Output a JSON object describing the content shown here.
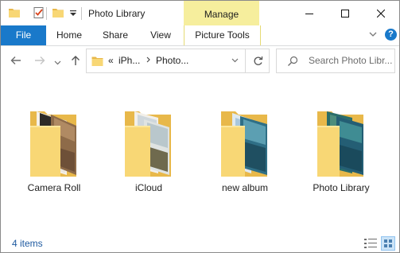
{
  "titlebar": {
    "title": "Photo Library",
    "contextual_tab": "Manage",
    "controls": {
      "minimize": "minimize",
      "maximize": "maximize",
      "close": "close"
    }
  },
  "ribbon": {
    "tabs": [
      {
        "label": "File"
      },
      {
        "label": "Home"
      },
      {
        "label": "Share"
      },
      {
        "label": "View"
      },
      {
        "label": "Picture Tools"
      }
    ],
    "help": "?"
  },
  "address": {
    "overflow": "«",
    "crumbs": [
      "iPh...",
      "Photo..."
    ]
  },
  "search": {
    "placeholder": "Search Photo Libr..."
  },
  "folders": [
    {
      "name": "Camera Roll"
    },
    {
      "name": "iCloud"
    },
    {
      "name": "new album"
    },
    {
      "name": "Photo Library"
    }
  ],
  "status": {
    "item_count": "4 items"
  },
  "colors": {
    "accent": "#1979ca",
    "manage_bg": "#f6ee9d",
    "folder": "#f8d775",
    "folder_back": "#e8b84a"
  }
}
